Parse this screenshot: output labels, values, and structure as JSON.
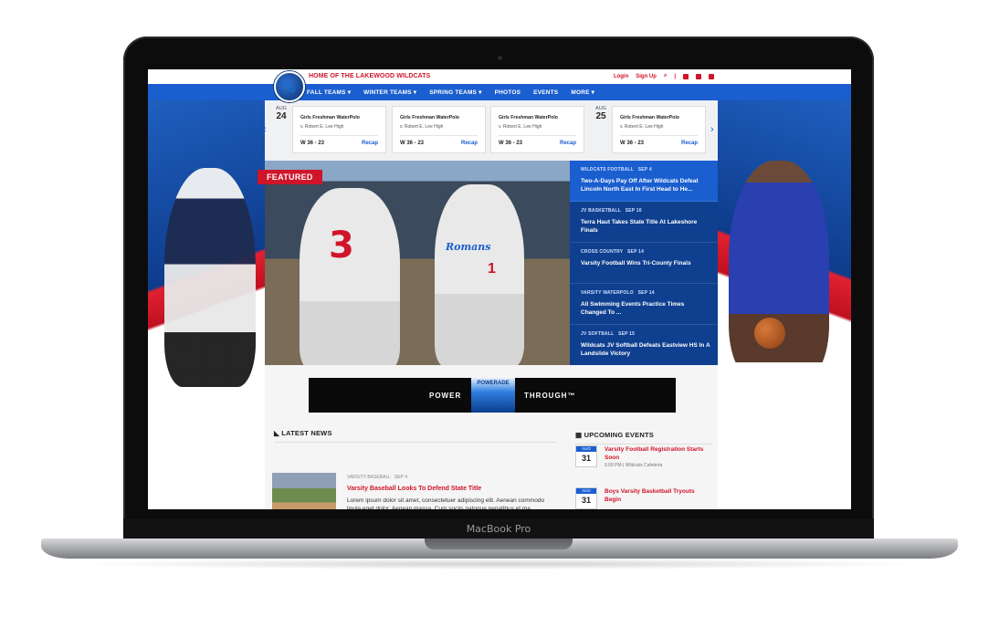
{
  "device": {
    "brand": "MacBook Pro"
  },
  "site": {
    "tagline": "HOME OF THE LAKEWOOD WILDCATS",
    "utility": {
      "login": "Login",
      "signup": "Sign Up"
    },
    "nav": [
      "FALL TEAMS ▾",
      "WINTER TEAMS ▾",
      "SPRING TEAMS ▾",
      "PHOTOS",
      "EVENTS",
      "MORE ▾"
    ]
  },
  "scores": {
    "dates": [
      {
        "month": "AUG",
        "day": "24"
      },
      {
        "month": "AUG",
        "day": "25"
      }
    ],
    "cards": [
      {
        "team": "Girls Freshman WaterPolo",
        "opponent": "v. Robert E. Lee High",
        "score": "W 36 - 23",
        "link": "Recap"
      },
      {
        "team": "Girls Freshman WaterPolo",
        "opponent": "v. Robert E. Lee High",
        "score": "W 36 - 23",
        "link": "Recap"
      },
      {
        "team": "Girls Freshman WaterPolo",
        "opponent": "v. Robert E. Lee High",
        "score": "W 36 - 23",
        "link": "Recap"
      },
      {
        "team": "Girls Freshman WaterPolo",
        "opponent": "v. Robert E. Lee High",
        "score": "W 36 - 23",
        "link": "Recap"
      }
    ]
  },
  "featured": {
    "badge": "FEATURED",
    "jersey_text": "Romans",
    "num_a": "3",
    "num_b": "1",
    "headlines": [
      {
        "category": "WILDCATS FOOTBALL",
        "date": "SEP 4",
        "title": "Two-A-Days Pay Off After Wildcats Defeat Lincoln North East In First Head to He..."
      },
      {
        "category": "JV BASKETBALL",
        "date": "SEP 10",
        "title": "Terra Haut Takes State Title At Lakeshore Finals"
      },
      {
        "category": "CROSS COUNTRY",
        "date": "SEP 14",
        "title": "Varsity Football Wins Tri-County Finals"
      },
      {
        "category": "VARSITY WATERPOLO",
        "date": "SEP 14",
        "title": "All Swimming Events Practice Times Changed To ..."
      },
      {
        "category": "JV SOFTBALL",
        "date": "SEP 15",
        "title": "Wildcats JV Softball Defeats Eastview HS In A Landslide Victory"
      }
    ]
  },
  "ad": {
    "left": "POWER",
    "right": "THROUGH™",
    "label": "POWERADE"
  },
  "news": {
    "section_title": "LATEST NEWS",
    "item": {
      "category": "VARSITY BASEBALL",
      "date": "SEP 4",
      "title": "Varsity Baseball Looks To Defend State Title",
      "body": "Lorem ipsum dolor sit amet, consectetuer adipiscing elit. Aenean commodo ligula eget dolor. Aenean massa. Cum sociis natoque penatibus et ma"
    }
  },
  "events": {
    "section_title": "UPCOMING EVENTS",
    "items": [
      {
        "month": "AUG",
        "day": "31",
        "title": "Varsity Football Registration Starts Soon",
        "detail": "6:00 PM | Wildcats Cafeteria"
      },
      {
        "month": "AUG",
        "day": "31",
        "title": "Boys Varsity Basketball Tryouts Begin",
        "detail": ""
      }
    ]
  },
  "colors": {
    "primary": "#1a5ecf",
    "accent": "#d0142a",
    "dark": "#0f3f8f"
  }
}
